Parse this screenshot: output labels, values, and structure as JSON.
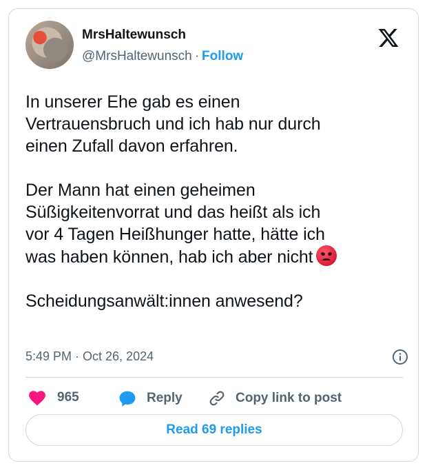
{
  "author": {
    "name": "MrsHaltewunsch",
    "handle": "@MrsHaltewunsch",
    "separator": "·",
    "follow_label": "Follow"
  },
  "tweet": {
    "lines_paragraph_1": [
      "In unserer Ehe gab es einen",
      "Vertrauensbruch und ich hab nur durch",
      "einen Zufall davon erfahren."
    ],
    "lines_paragraph_2": [
      "Der Mann hat einen geheimen",
      "Süßigkeitenvorrat und das heißt als ich",
      "vor 4 Tagen Heißhunger hatte, hätte ich",
      "was haben können, hab ich aber nicht"
    ],
    "trailing_emoji": "angry-face-emoji",
    "lines_paragraph_3": [
      "Scheidungsanwält:innen anwesend?"
    ],
    "timestamp": "5:49 PM · Oct 26, 2024"
  },
  "actions": {
    "like_count": "965",
    "reply_label": "Reply",
    "copy_label": "Copy link to post"
  },
  "footer": {
    "read_replies_label": "Read 69 replies"
  },
  "colors": {
    "accent": "#1d9bf0",
    "like": "#f91880",
    "muted": "#536471",
    "border": "#cfd9de"
  },
  "icons": [
    "x-logo-icon",
    "info-icon",
    "heart-icon",
    "reply-bubble-icon",
    "link-icon"
  ]
}
